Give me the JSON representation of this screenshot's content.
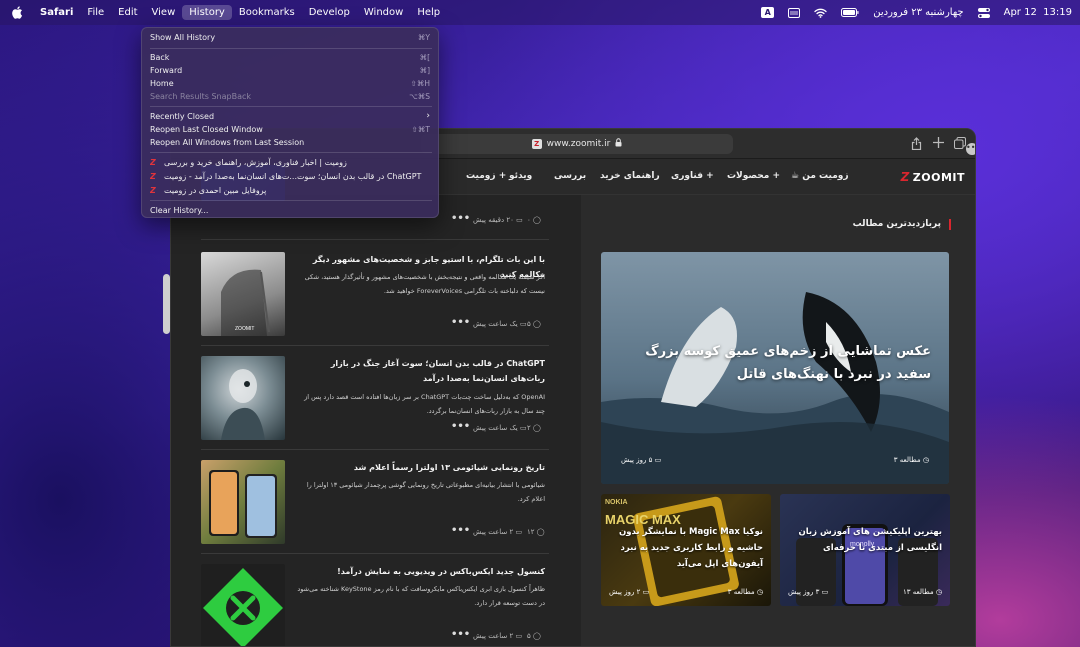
{
  "menubar": {
    "app": "Safari",
    "menus": [
      "File",
      "Edit",
      "View",
      "History",
      "Bookmarks",
      "Develop",
      "Window",
      "Help"
    ],
    "active_menu": "History",
    "status": {
      "input_source": "A",
      "date_local": "چهارشنبه ۲۳ فروردین",
      "date": "Apr 12",
      "time": "13:19"
    }
  },
  "history_menu": {
    "items": [
      {
        "label": "Show All History",
        "shortcut": "⌘Y",
        "disabled": false
      },
      {
        "label": "Back",
        "shortcut": "⌘[",
        "disabled": false
      },
      {
        "label": "Forward",
        "shortcut": "⌘]",
        "disabled": false
      },
      {
        "label": "Home",
        "shortcut": "⇧⌘H",
        "disabled": false
      },
      {
        "label": "Search Results SnapBack",
        "shortcut": "⌥⌘S",
        "disabled": true
      },
      {
        "label": "Recently Closed",
        "shortcut": "",
        "disabled": false
      },
      {
        "label": "Reopen Last Closed Window",
        "shortcut": "⇧⌘T",
        "disabled": false
      },
      {
        "label": "Reopen All Windows from Last Session",
        "shortcut": "",
        "disabled": false
      }
    ],
    "recent": [
      "زومیت | اخبار فناوری، آموزش، راهنمای خرید و بررسی",
      "ChatGPT در قالب بدن انسان؛ سوت...ت‌های انسان‌نما به‌صدا درآمد - زومیت",
      "پروفایل مبین احمدی در زومیت"
    ],
    "clear": "Clear History..."
  },
  "browser": {
    "url": "www.zoomit.ir",
    "favicon_letter": "Z"
  },
  "site": {
    "logo_text": "ZOOMIT",
    "nav": [
      "زومیت من",
      "محصولات +",
      "فناوری +",
      "راهنمای خرید",
      "بررسی",
      "ویدئو",
      "زومیت +"
    ],
    "popular_heading": "پربازدیدترین مطالب",
    "hero": {
      "title": "عکس تماشایی از زخم‌های عمیق کوسه بزرگ سفید در نبرد با نهنگ‌های قاتل",
      "reading": "مطالعه ۳",
      "time": "۵ روز پیش"
    },
    "cards": [
      {
        "title": "نوکیا Magic Max با نمایشگر بدون حاشیه و رابط کاربری جدید به نبرد آیفون‌های اپل می‌آید",
        "reading": "مطالعه ۳",
        "time": "۲ روز پیش",
        "brand": "NOKIA",
        "product": "MAGIC MAX"
      },
      {
        "title": "بهترین اپلیکیشن های آموزش زبان انگلیسی از مبتدی تا حرفه‌ای",
        "reading": "مطالعه ۱۳",
        "time": "۳ روز پیش",
        "app_word": "monolly"
      }
    ],
    "feed": [
      {
        "title": "",
        "desc": "",
        "time": "۲۰ دقیقه پیش",
        "comments": "۰"
      },
      {
        "title": "با این بات تلگرام، با استیو جابز و شخصیت‌های مشهور دیگر مکالمه کنید",
        "desc": "اگر شیفته یک مکالمه واقعی و نتیجه‌بخش با شخصیت‌های مشهور و تأثیرگذار هستید، شکی نیست که دلباخته بات تلگرامی ForeverVoices خواهید شد.",
        "time": "یک ساعت پیش",
        "comments": "۵"
      },
      {
        "title": "ChatGPT در قالب بدن انسان؛ سوت آغاز جنگ در بازار ربات‌های انسان‌نما به‌صدا درآمد",
        "desc": "OpenAI که به‌دلیل ساخت چت‌بات ChatGPT بر سر زبان‌ها افتاده است قصد دارد پس از چند سال به بازار ربات‌های انسان‌نما برگردد.",
        "time": "یک ساعت پیش",
        "comments": "۲"
      },
      {
        "title": "تاریخ رونمایی شیائومی ۱۳ اولترا رسماً اعلام شد",
        "desc": "شیائومی با انتشار بیانیه‌ای مطبوعاتی تاریخ رونمایی گوشی پرچمدار شیائومی ۱۳ اولترا را اعلام کرد.",
        "time": "۲ ساعت پیش",
        "comments": "۱۲"
      },
      {
        "title": "کنسول جدید ایکس‌باکس در ویدیویی به نمایش درآمد!",
        "desc": "ظاهراً کنسول بازی ابری ایکس‌باکس مایکروسافت که با نام رمز KeyStone شناخته می‌شود در دست توسعه قرار دارد.",
        "time": "۲ ساعت پیش",
        "comments": "۵"
      }
    ],
    "thumb_watermark": "ZOOMIT"
  }
}
